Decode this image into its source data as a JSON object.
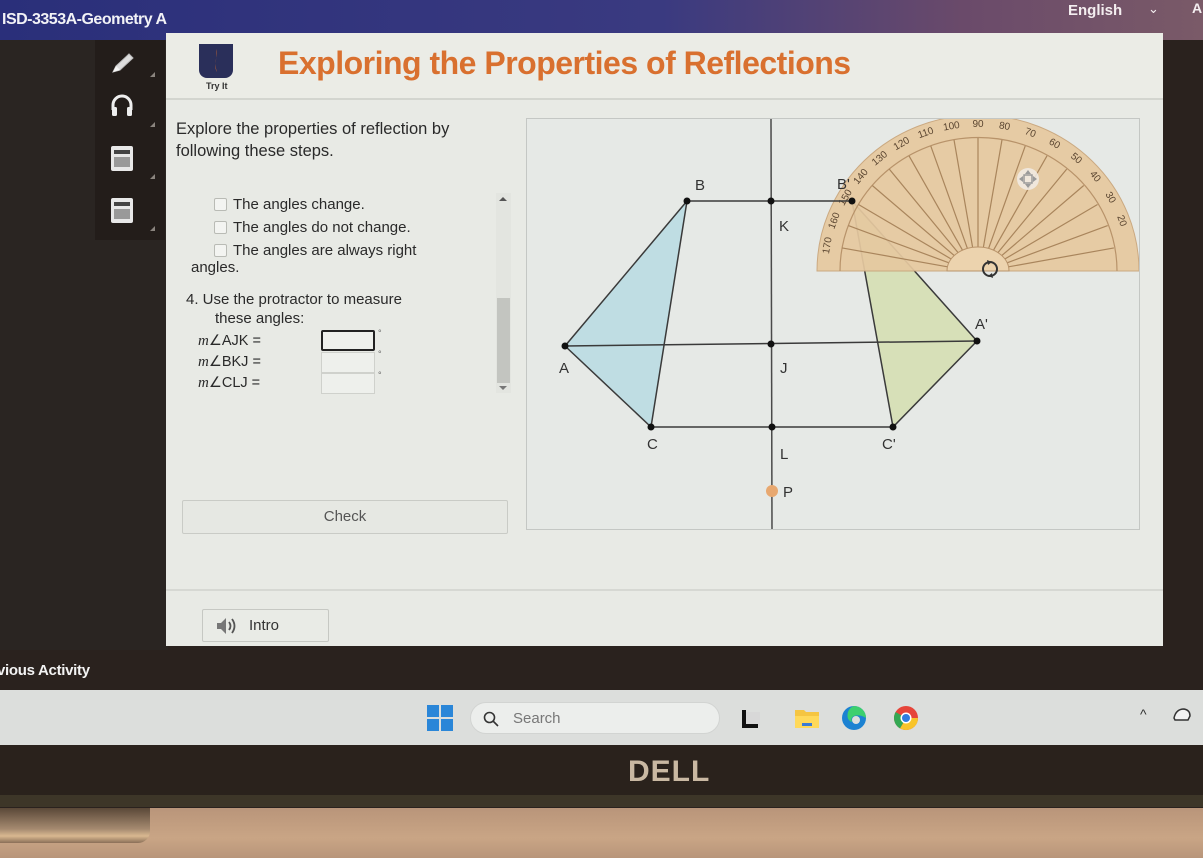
{
  "topbar": {
    "course_title": "ISD-3353A-Geometry A",
    "language": "English",
    "language_chevron": "⌄",
    "extra_glyph": "A"
  },
  "toolbar": {
    "tools": [
      {
        "name": "pencil-icon"
      },
      {
        "name": "headphones-icon"
      },
      {
        "name": "calculator-icon"
      },
      {
        "name": "calculator-icon"
      }
    ]
  },
  "header": {
    "badge_label": "Try It",
    "title": "Exploring the Properties of Reflections",
    "accent_color": "#d9702f"
  },
  "main": {
    "instructions": "Explore the properties of reflection by following these steps.",
    "options": [
      {
        "label": "The angles change.",
        "checked": false
      },
      {
        "label": "The angles do not change.",
        "checked": false
      },
      {
        "label": "The angles are always right",
        "checked": false
      }
    ],
    "option_wrap": "angles.",
    "question4": "4. Use the protractor to measure",
    "question4_sub": "these angles:",
    "angles": [
      {
        "m": "m",
        "label": "∠AJK =",
        "value": "",
        "degree": "°"
      },
      {
        "m": "m",
        "label": "∠BKJ =",
        "value": "",
        "degree": "°"
      },
      {
        "m": "m",
        "label": "∠CLJ =",
        "value": "",
        "degree": "°"
      }
    ],
    "check_label": "Check",
    "intro_label": "Intro"
  },
  "geometry": {
    "points": {
      "B": "B",
      "K": "K",
      "A": "A",
      "J": "J",
      "C": "C",
      "L": "L",
      "P": "P",
      "B_prime": "B'",
      "A_prime": "A'",
      "C_prime": "C'"
    },
    "protractor_labels": [
      "170",
      "160",
      "150",
      "140",
      "130",
      "120",
      "110",
      "100",
      "90",
      "80",
      "70",
      "60",
      "50",
      "40",
      "30",
      "20"
    ],
    "colors": {
      "preimage_fill": "#bfdde3",
      "image_fill": "#d7e0b8",
      "protractor_fill": "#e6c9a0",
      "point_p": "#e8a870"
    }
  },
  "footer": {
    "previous_activity": "vious Activity"
  },
  "taskbar": {
    "search_placeholder": "Search",
    "tray_chevron": "^"
  },
  "bezel": {
    "brand": "DELL"
  }
}
